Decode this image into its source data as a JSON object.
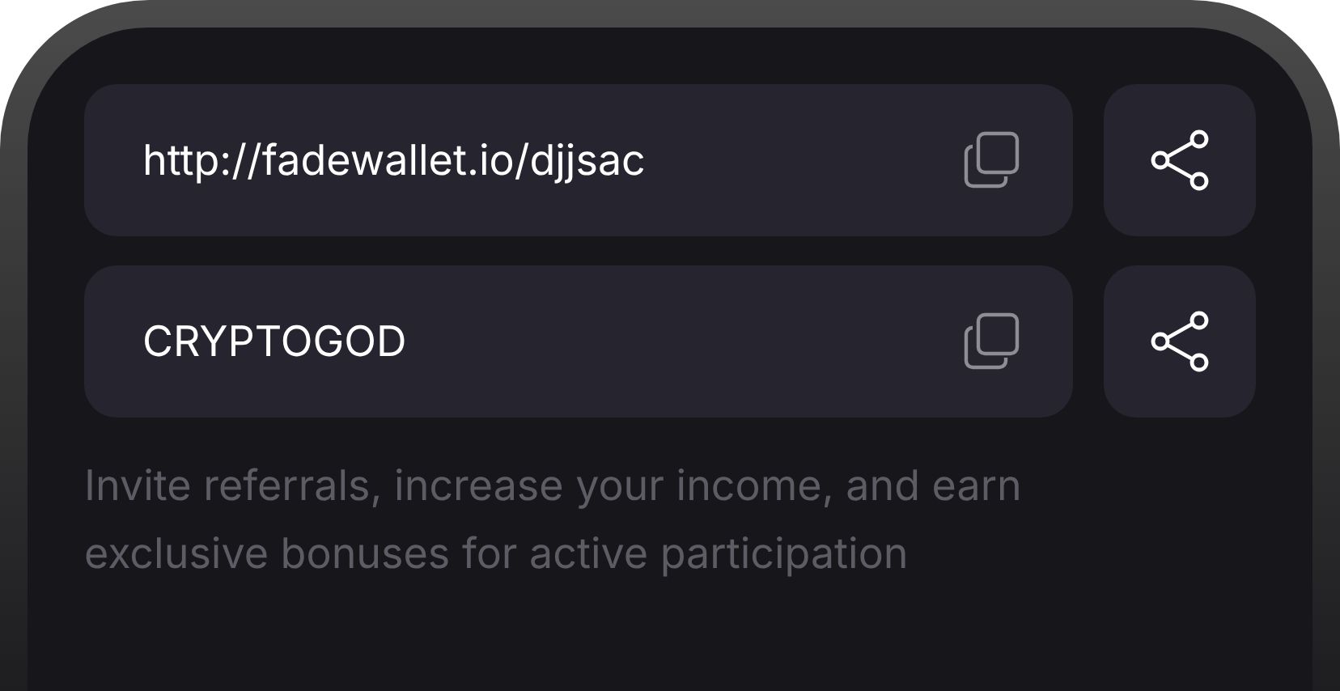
{
  "rows": [
    {
      "value": "http://fadewallet.io/djjsac"
    },
    {
      "value": "CRYPTOGOD"
    }
  ],
  "description": "Invite referrals, increase your income, and earn exclusive bonuses for active participation"
}
